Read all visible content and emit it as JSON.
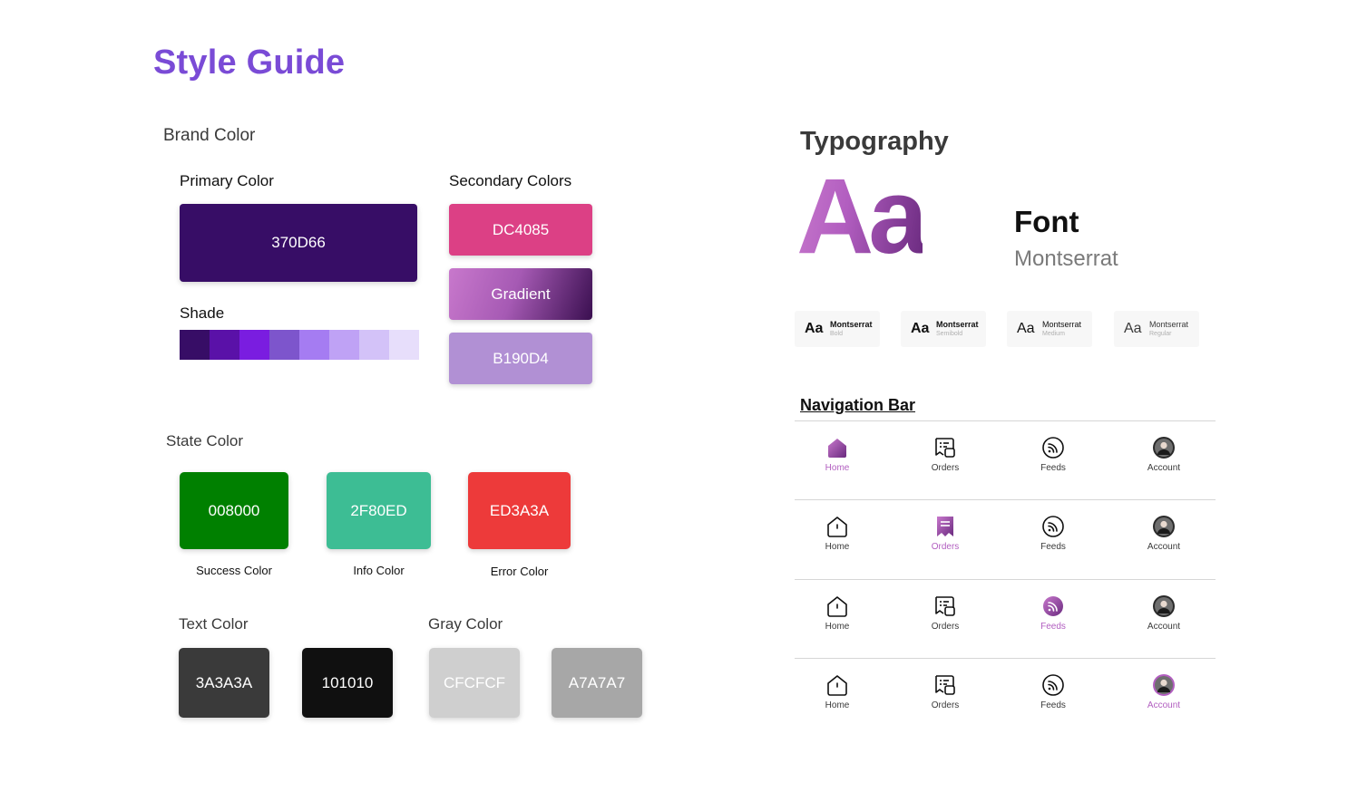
{
  "page": {
    "title": "Style Guide"
  },
  "brand": {
    "heading": "Brand Color",
    "primary": {
      "label": "Primary Color",
      "hex": "370D66",
      "color": "#370D66"
    },
    "shade": {
      "label": "Shade",
      "colors": [
        "#370D66",
        "#5A11A8",
        "#7A1DE0",
        "#7D55CC",
        "#A57CF2",
        "#BFA2F5",
        "#D3C2F8",
        "#E7DEFB"
      ]
    },
    "secondary": {
      "label": "Secondary Colors",
      "pink": {
        "hex": "DC4085",
        "color": "#DC4085"
      },
      "gradient": {
        "label": "Gradient",
        "from": "#C878CC",
        "to": "#3A0F50"
      },
      "lilac": {
        "hex": "B190D4",
        "color": "#B190D4"
      }
    }
  },
  "state": {
    "heading": "State Color",
    "success": {
      "hex": "008000",
      "caption": "Success Color",
      "color": "#008000"
    },
    "info": {
      "hex": "2F80ED",
      "caption": "Info Color",
      "color": "#3DBD94"
    },
    "error": {
      "hex": "ED3A3A",
      "caption": "Error Color",
      "color": "#ED3A3A"
    }
  },
  "text_color": {
    "heading": "Text Color",
    "c1": {
      "hex": "3A3A3A",
      "color": "#3A3A3A"
    },
    "c2": {
      "hex": "101010",
      "color": "#101010"
    }
  },
  "gray_color": {
    "heading": "Gray Color",
    "c1": {
      "hex": "CFCFCF",
      "color": "#CFCFCF"
    },
    "c2": {
      "hex": "A7A7A7",
      "color": "#A7A7A7"
    }
  },
  "typography": {
    "heading": "Typography",
    "sample": "Aa",
    "font_label": "Font",
    "font_name": "Montserrat",
    "weights": [
      {
        "aa": "Aa",
        "name": "Montserrat",
        "weight": "Bold"
      },
      {
        "aa": "Aa",
        "name": "Montserrat",
        "weight": "Semibold"
      },
      {
        "aa": "Aa",
        "name": "Montserrat",
        "weight": "Medium"
      },
      {
        "aa": "Aa",
        "name": "Montserrat",
        "weight": "Regular"
      }
    ]
  },
  "navbar": {
    "heading": "Navigation Bar",
    "labels": {
      "home": "Home",
      "orders": "Orders",
      "feeds": "Feeds",
      "account": "Account"
    },
    "active_color": "#B25EC0",
    "rows": [
      {
        "active": "home"
      },
      {
        "active": "orders"
      },
      {
        "active": "feeds"
      },
      {
        "active": "account"
      }
    ]
  }
}
